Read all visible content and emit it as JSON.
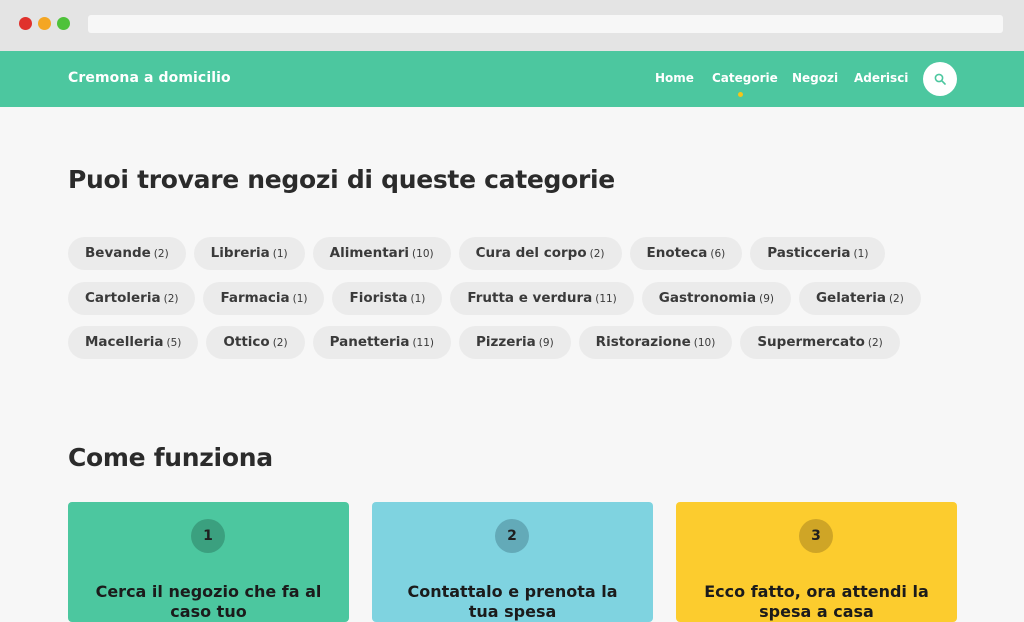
{
  "header": {
    "brand": "Cremona a domicilio",
    "nav": [
      {
        "label": "Home"
      },
      {
        "label": "Categorie",
        "active": true
      },
      {
        "label": "Negozi"
      },
      {
        "label": "Aderisci"
      }
    ],
    "search_icon": "search-icon"
  },
  "categories": {
    "title": "Puoi trovare negozi di queste categorie",
    "items": [
      {
        "name": "Bevande",
        "count": "(2)"
      },
      {
        "name": "Libreria",
        "count": "(1)"
      },
      {
        "name": "Alimentari",
        "count": "(10)"
      },
      {
        "name": "Cura del corpo",
        "count": "(2)"
      },
      {
        "name": "Enoteca",
        "count": "(6)"
      },
      {
        "name": "Pasticceria",
        "count": "(1)"
      },
      {
        "name": "Cartoleria",
        "count": "(2)"
      },
      {
        "name": "Farmacia",
        "count": "(1)"
      },
      {
        "name": "Fiorista",
        "count": "(1)"
      },
      {
        "name": "Frutta e verdura",
        "count": "(11)"
      },
      {
        "name": "Gastronomia",
        "count": "(9)"
      },
      {
        "name": "Gelateria",
        "count": "(2)"
      },
      {
        "name": "Macelleria",
        "count": "(5)"
      },
      {
        "name": "Ottico",
        "count": "(2)"
      },
      {
        "name": "Panetteria",
        "count": "(11)"
      },
      {
        "name": "Pizzeria",
        "count": "(9)"
      },
      {
        "name": "Ristorazione",
        "count": "(10)"
      },
      {
        "name": "Supermercato",
        "count": "(2)"
      }
    ]
  },
  "how": {
    "title": "Come funziona",
    "steps": [
      {
        "number": "1",
        "text": "Cerca il negozio che fa al caso tuo"
      },
      {
        "number": "2",
        "text": "Contattalo e prenota la tua spesa"
      },
      {
        "number": "3",
        "text": "Ecco fatto, ora attendi la spesa a casa"
      }
    ]
  },
  "colors": {
    "header": "#4cc79f",
    "accent_dot": "#f5c518",
    "card1": "#4cc79f",
    "card2": "#7fd3e0",
    "card3": "#fccc2e"
  }
}
